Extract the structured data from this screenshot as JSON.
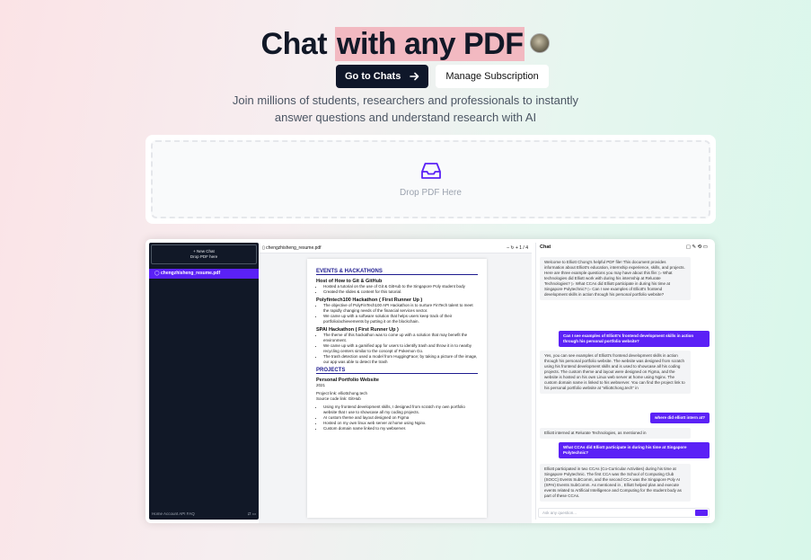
{
  "hero": {
    "title_start": "Chat ",
    "title_highlight": "with any PDF",
    "go_button": "Go to Chats",
    "manage_button": "Manage Subscription",
    "subtitle_line1": "Join millions of students, researchers and professionals to instantly",
    "subtitle_line2": "answer questions and understand research with AI"
  },
  "dropzone": {
    "label": "Drop PDF Here"
  },
  "app": {
    "sidebar": {
      "new_chat": "+ New Chat",
      "new_chat_sub": "Drop PDF here",
      "chat_item": "chengzhisheng_resume.pdf",
      "footer_links": "Home  Account  API  FAQ"
    },
    "pdf": {
      "filename": "chengzhisheng_resume.pdf",
      "page_indicator": "1 / 4",
      "sections": {
        "events": "EVENTS & HACKATHONS",
        "projects": "PROJECTS"
      },
      "items": {
        "git_title": "Host of How to Git & GitHub",
        "git_b1": "Hosted a tutorial on the use of Git & GitHub to the Singapore Poly student body",
        "git_b2": "Created the slides & content for this tutorial.",
        "pf_title": "Polyfintech100 Hackathon ( First Runner Up )",
        "pf_b1": "The objective of PolyFinTech100 API Hackathon is to nurture FinTech talent to meet the rapidly changing needs of the financial services sector.",
        "pf_b2": "We came up with a software solution that helps users keep track of their portfolio/achievements by putting it on the blockchain.",
        "spai_title": "SPAI Hackathon ( First Runner Up )",
        "spai_b1": "The theme of this hackathon was to come up with a solution that may benefit the environment.",
        "spai_b2": "We came up with a gamified app for users to identify trash and throw it in to nearby recycling centers similar to the concept of Pokemon Go.",
        "spai_b3": "The trash detection used a model from HuggingFace; by taking a picture of the image, our app was able to detect the trash",
        "proj_title": "Personal Portfolio Website",
        "proj_year": "2021",
        "proj_link": "Project link: elliottchong.tech",
        "proj_source": "Source code link: GitHub",
        "proj_b1": "Using my frontend development skills, I designed from scratch my own portfolio website that I use to showcase all my coding projects.",
        "proj_b2": "AI custom theme and layout designed on Figma",
        "proj_b3": "Hosted on my own linux web server at home using Nginx.",
        "proj_b4": "Custom domain name linked to my webserver."
      }
    },
    "chat": {
      "title": "Chat",
      "m1": "Welcome to Elliott Chong's helpful PDF file! This document provides information about Elliott's education, internship experience, skills, and projects. Here are three example questions you may have about this file: ▷ What technologies did Elliott work with during his internship at Relurate Technologies? ▷ What CCAs did Elliott participate in during his time at Singapore Polytechnic? ▷ Can I see examples of Elliott's frontend development skills in action through his personal portfolio website?",
      "u1": "Can I see examples of Elliott's frontend development skills in action through his personal portfolio website?",
      "m2": "Yes, you can see examples of Elliott's frontend development skills in action through his personal portfolio website. The website was designed from scratch using his frontend development skills and is used to showcase all his coding projects. The custom theme and layout were designed on Figma, and the website is hosted on his own Linux web server at home using Nginx. The custom domain name is linked to his webserver. You can find the project link to his personal portfolio website at \"elliottchong.tech\" in",
      "u2": "where did elliott intern at?",
      "m3": "Elliott interned at Relurate Technologies, as mentioned in",
      "u3": "What CCAs did Elliott participate in during his time at Singapore Polytechnic?",
      "m4": "Elliott participated in two CCAs (Co-Curricular Activities) during his time at Singapore Polytechnic. The first CCA was the School of Computing Club (SOCC) Events SubComm, and the second CCA was the Singapore Poly AI (SPAI) Events SubComm. As mentioned in , Elliott helped plan and execute events related to Artificial Intelligence and Computing for the student body as part of these CCAs.",
      "placeholder": "Ask any question..."
    }
  }
}
